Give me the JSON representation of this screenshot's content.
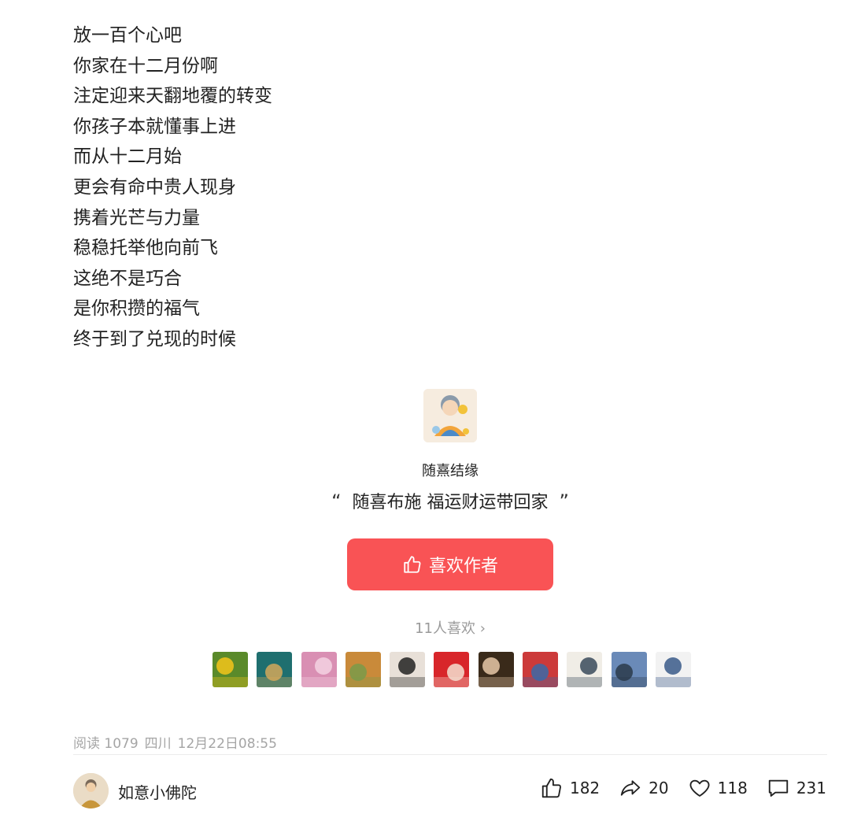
{
  "poem_lines": [
    "放一百个心吧",
    "你家在十二月份啊",
    "注定迎来天翻地覆的转变",
    "你孩子本就懂事上进",
    "而从十二月始",
    "更会有命中贵人现身",
    "携着光芒与力量",
    "稳稳托举他向前飞",
    "这绝不是巧合",
    "是你积攒的福气",
    "终于到了兑现的时候"
  ],
  "author_card": {
    "name": "随熹结缘",
    "quote_open": "“",
    "quote_text": "随喜布施 福运财运带回家",
    "quote_close": "”",
    "like_button_label": "喜欢作者",
    "like_count_text": "11人喜欢",
    "like_count_arrow": "›"
  },
  "fans": [
    {
      "name": "fan-avatar-yellow-flowers",
      "colors": [
        "#5a8a2a",
        "#f4c41a"
      ]
    },
    {
      "name": "fan-avatar-buddha-figure",
      "colors": [
        "#1f6f6f",
        "#d4a85a"
      ]
    },
    {
      "name": "fan-avatar-pink-blossom",
      "colors": [
        "#d98fb3",
        "#f3d2e2"
      ]
    },
    {
      "name": "fan-avatar-sunset-field",
      "colors": [
        "#c98a3a",
        "#7a9a4a"
      ]
    },
    {
      "name": "fan-avatar-cartoon-girl",
      "colors": [
        "#e8e0d8",
        "#222222"
      ]
    },
    {
      "name": "fan-avatar-red-cartoon",
      "colors": [
        "#d8262a",
        "#f4e0d0"
      ]
    },
    {
      "name": "fan-avatar-woman-portrait",
      "colors": [
        "#3a2a1a",
        "#e8c8a8"
      ]
    },
    {
      "name": "fan-avatar-red-tulips",
      "colors": [
        "#cc3a3a",
        "#3a6aa8"
      ]
    },
    {
      "name": "fan-avatar-calligraphy",
      "colors": [
        "#f0ede6",
        "#3a4a5a"
      ]
    },
    {
      "name": "fan-avatar-city-skyline",
      "colors": [
        "#6a8ab8",
        "#2a3a4a"
      ]
    },
    {
      "name": "fan-avatar-girl-laptop",
      "colors": [
        "#f2f2f2",
        "#3a5a8a"
      ]
    }
  ],
  "meta": {
    "read_label": "阅读 1079",
    "location": "四川",
    "time": "12月22日08:55"
  },
  "footer": {
    "author_name": "如意小佛陀",
    "likes": "182",
    "shares": "20",
    "favorites": "118",
    "comments": "231"
  },
  "colors": {
    "accent": "#f95355",
    "muted": "#a5a5a5",
    "text": "#222222"
  },
  "icons": {
    "like_button_icon": "thumbs-up-icon",
    "likes": "thumbs-up-icon",
    "shares": "share-arrow-icon",
    "favorites": "heart-icon",
    "comments": "comment-bubble-icon"
  }
}
